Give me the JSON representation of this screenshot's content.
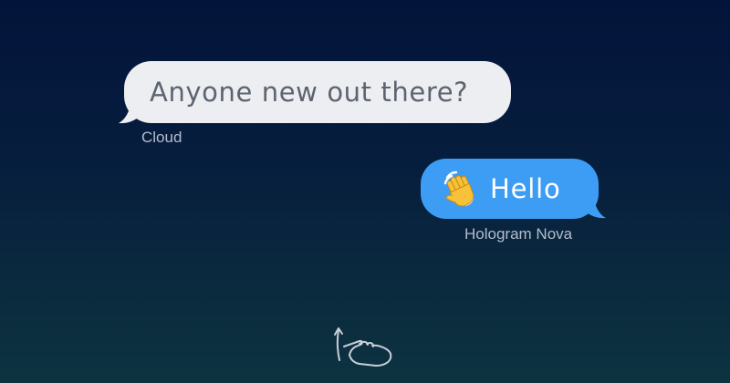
{
  "messages": {
    "incoming": {
      "text": "Anyone new out there?",
      "sender": "Cloud",
      "bubble_color": "#eceef2"
    },
    "outgoing": {
      "emoji": "waving-hand-icon",
      "text": "Hello",
      "sender": "Hologram Nova",
      "bubble_color": "#3d9df4"
    }
  },
  "hint": {
    "icon": "swipe-up-hand-icon"
  },
  "colors": {
    "background_top": "#03143a",
    "background_bottom": "#0d3340",
    "sender_label": "#b4bccb"
  }
}
